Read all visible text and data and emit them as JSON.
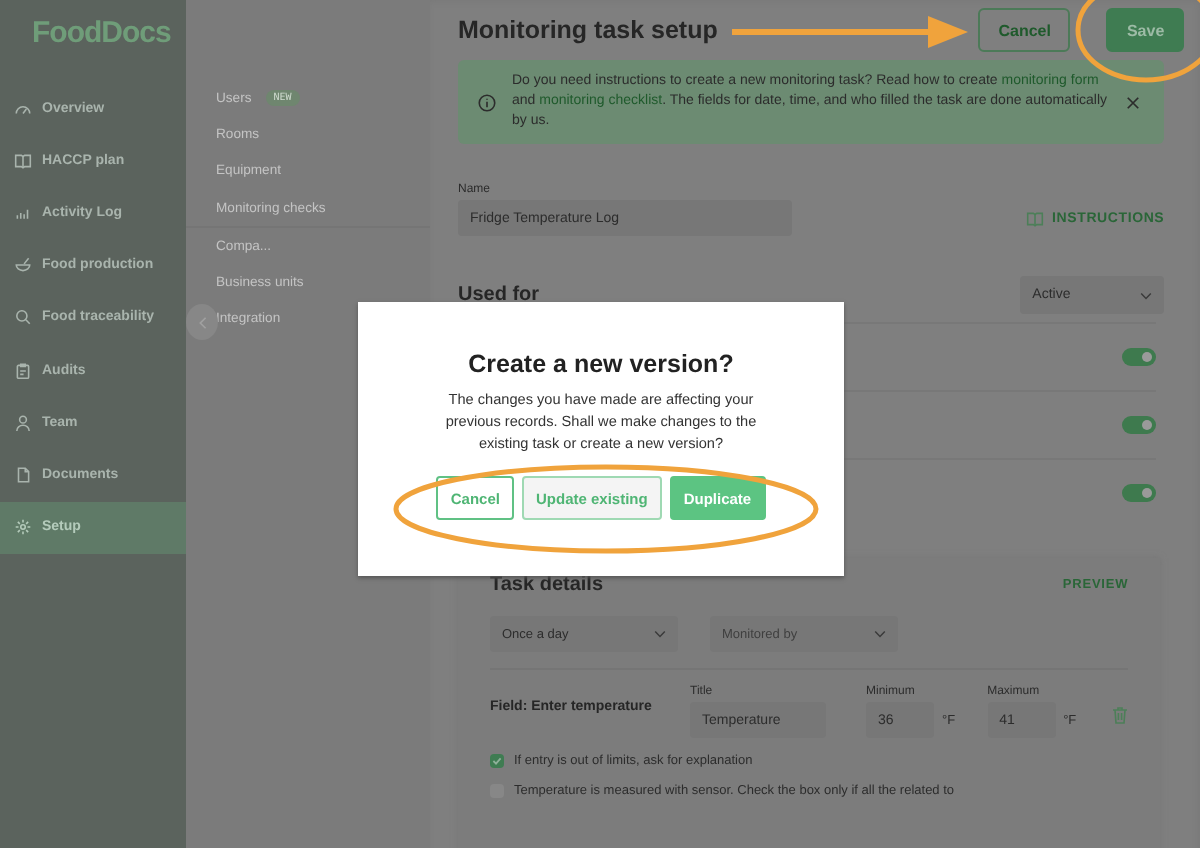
{
  "sidebar": {
    "logo": "FoodDocs",
    "items": [
      {
        "label": "Overview",
        "selected": false
      },
      {
        "label": "HACCP plan",
        "selected": false
      },
      {
        "label": "Activity Log",
        "selected": false
      },
      {
        "label": "Food production",
        "selected": false
      },
      {
        "label": "Food traceability",
        "selected": false
      },
      {
        "label": "Audits",
        "selected": false
      },
      {
        "label": "Team",
        "selected": false
      },
      {
        "label": "Documents",
        "selected": false
      },
      {
        "label": "Setup",
        "selected": true
      }
    ]
  },
  "submenu": {
    "groups": [
      [
        {
          "label": "Users",
          "badge": "NEW"
        },
        {
          "label": "Rooms"
        },
        {
          "label": "Equipment"
        },
        {
          "label": "Monitoring checks"
        }
      ],
      [
        {
          "label": "Compa..."
        },
        {
          "label": "Business units"
        },
        {
          "label": "Integration"
        }
      ]
    ]
  },
  "page": {
    "title": "Monitoring task setup",
    "buttons": [
      {
        "label": "Cancel",
        "kind": "secondary"
      },
      {
        "label": "Save",
        "kind": "primary"
      }
    ]
  },
  "banner": {
    "parts": [
      {
        "kind": "text",
        "text": "Do you need instructions to create a new monitoring task? Read how to create "
      },
      {
        "kind": "link",
        "text": "monitoring form"
      },
      {
        "kind": "text",
        "text": " and "
      },
      {
        "kind": "link",
        "text": "monitoring checklist"
      },
      {
        "kind": "text",
        "text": ". The fields for date, time, and who filled the task are done automatically by us."
      }
    ]
  },
  "name_field": {
    "label": "Name",
    "value": "Fridge Temperature Log"
  },
  "instructions_link": "INSTRUCTIONS",
  "used_for": {
    "title": "Used for",
    "status": "Active",
    "toggles": [
      {
        "on": true
      },
      {
        "on": true
      },
      {
        "on": true
      }
    ]
  },
  "task_details": {
    "title": "Task details",
    "preview": "PREVIEW",
    "frequency": "Once a day",
    "monitored_by_placeholder": "Monitored by",
    "field": {
      "label": "Field: Enter temperature",
      "title_label": "Title",
      "title_value": "Temperature",
      "min_label": "Minimum",
      "min_value": "36",
      "min_unit": "°F",
      "max_label": "Maximum",
      "max_value": "41",
      "max_unit": "°F"
    },
    "options": [
      {
        "label": "If entry is out of limits, ask for explanation",
        "checked": true
      },
      {
        "label": "Temperature is measured with sensor. Check the box only if all the related to",
        "checked": false
      }
    ]
  },
  "dialog": {
    "title": "Create a new version?",
    "message": "The changes you have made are affecting your previous records. Shall we make changes to the existing task or create a new version?",
    "buttons": [
      {
        "label": "Cancel",
        "kind": "outline"
      },
      {
        "label": "Update existing",
        "kind": "secondary"
      },
      {
        "label": "Duplicate",
        "kind": "primary"
      }
    ]
  }
}
